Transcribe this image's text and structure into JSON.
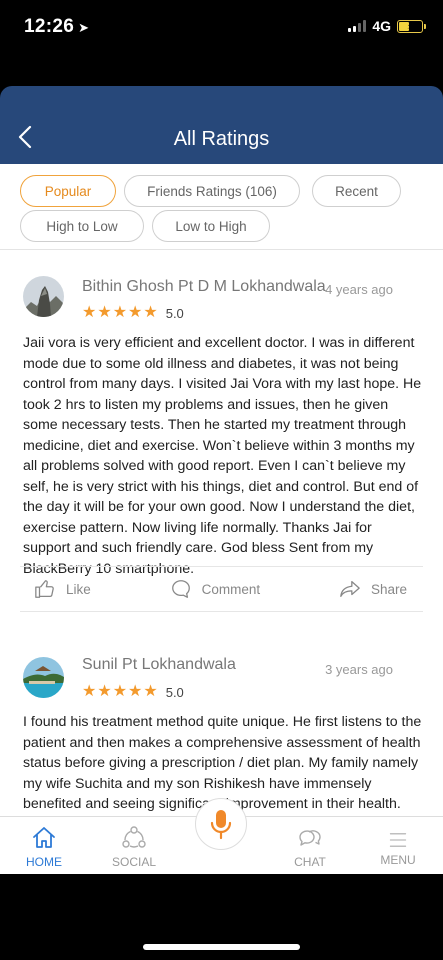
{
  "status_bar": {
    "time": "12:26",
    "network": "4G"
  },
  "header": {
    "title": "All Ratings"
  },
  "filters": [
    {
      "label": "Popular",
      "active": true
    },
    {
      "label": "Friends Ratings (106)",
      "active": false
    },
    {
      "label": "Recent",
      "active": false
    },
    {
      "label": "High to Low",
      "active": false
    },
    {
      "label": "Low to High",
      "active": false
    }
  ],
  "reviews": [
    {
      "name": "Bithin Ghosh Pt D M Lokhandwala",
      "time": "4 years ago",
      "rating": "5.0",
      "stars": 5,
      "text": "Jaii vora is very efficient and excellent doctor. I was in different mode due to some old illness and diabetes, it was not being control from many days. I visited Jai Vora with my last hope. He took 2 hrs to listen my problems and issues, then he given some necessary tests. Then he started my treatment through medicine, diet and exercise. Won`t believe within 3 months my all problems solved with good report. Even I can`t believe my self, he is very strict with his things, diet and control. But end of the day it will be for your own good. Now I understand the diet, exercise pattern. Now living life normally. Thanks Jai for support and such friendly care. God bless Sent from my BlackBerry 10 smartphone."
    },
    {
      "name": "Sunil Pt Lokhandwala",
      "time": "3 years ago",
      "rating": "5.0",
      "stars": 5,
      "text": "I found his treatment method quite unique. He first listens to the patient and then makes a comprehensive assessment of health status before giving a prescription / diet plan. My family namely my wife Suchita and my son Rishikesh have immensely benefited and seeing significant improvement in their health."
    }
  ],
  "actions": {
    "like": "Like",
    "comment": "Comment",
    "share": "Share"
  },
  "tabbar": {
    "home": "HOME",
    "social": "SOCIAL",
    "chat": "CHAT",
    "menu": "MENU"
  },
  "colors": {
    "header": "#27487a",
    "accent": "#f39a2d",
    "active_tab": "#2d7ad6"
  }
}
